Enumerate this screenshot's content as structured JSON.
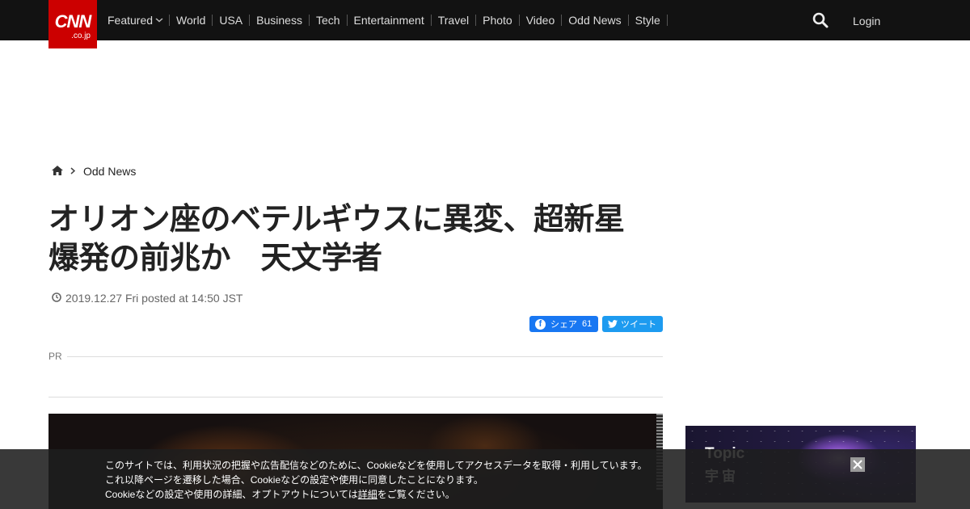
{
  "header": {
    "logo_text": "CNN",
    "logo_sub": ".co.jp",
    "nav": [
      {
        "label": "Featured",
        "has_dropdown": true
      },
      {
        "label": "World"
      },
      {
        "label": "USA"
      },
      {
        "label": "Business"
      },
      {
        "label": "Tech"
      },
      {
        "label": "Entertainment"
      },
      {
        "label": "Travel"
      },
      {
        "label": "Photo"
      },
      {
        "label": "Video"
      },
      {
        "label": "Odd News"
      },
      {
        "label": "Style"
      }
    ],
    "search_icon": "search-icon",
    "login_label": "Login"
  },
  "breadcrumb": {
    "home_icon": "home-icon",
    "category": "Odd News"
  },
  "article": {
    "title": "オリオン座のベテルギウスに異変、超新星爆発の前兆か　天文学者",
    "date": "2019.12.27 Fri posted at 14:50 JST",
    "share": {
      "facebook_label": "シェア",
      "facebook_count": "61",
      "twitter_label": "ツイート"
    },
    "pr_label": "PR"
  },
  "sidebar": {
    "topic_label": "Topic",
    "topic_name": "宇宙"
  },
  "cookie_notice": {
    "line1": "このサイトでは、利用状況の把握や広告配信などのために、Cookieなどを使用してアクセスデータを取得・利用しています。",
    "line2": "これ以降ページを遷移した場合、Cookieなどの設定や使用に同意したことになります。",
    "line3_pre": "Cookieなどの設定や使用の詳細、オプトアウトについては",
    "line3_link": "詳細",
    "line3_post": "をご覧ください。"
  },
  "colors": {
    "brand_red": "#cc0000",
    "nav_bg": "#121212",
    "facebook": "#1877f2",
    "twitter": "#1d9bf0"
  }
}
